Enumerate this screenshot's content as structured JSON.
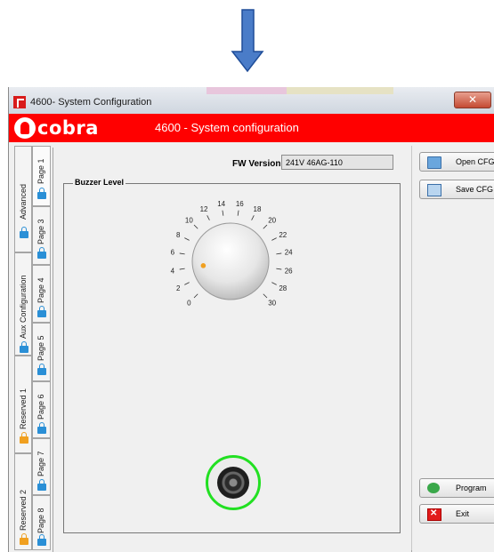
{
  "window": {
    "title": "4600- System Configuration",
    "close_label": "✕"
  },
  "header": {
    "logo_text": "cobra",
    "title": "4600 - System configuration",
    "color": "#ff0000"
  },
  "tabs": {
    "groups": [
      {
        "label": "Advanced",
        "icon": "lock-icon"
      },
      {
        "label": "Aux Configuration",
        "icon": "lock-icon"
      },
      {
        "label": "Reserved 1",
        "icon": "lock-icon"
      },
      {
        "label": "Reserved 2",
        "icon": "lock-icon"
      }
    ],
    "pages": [
      {
        "label": "Page 1"
      },
      {
        "label": "Page 3"
      },
      {
        "label": "Page 4"
      },
      {
        "label": "Page 5"
      },
      {
        "label": "Page 6"
      },
      {
        "label": "Page 7"
      },
      {
        "label": "Page 8"
      }
    ]
  },
  "fw": {
    "label": "FW Version",
    "value": "241V 46AG-110"
  },
  "buzzer": {
    "group_title": "Buzzer Level",
    "scale": [
      "0",
      "2",
      "4",
      "6",
      "8",
      "10",
      "12",
      "14",
      "16",
      "18",
      "20",
      "22",
      "24",
      "26",
      "28",
      "30"
    ],
    "level": 4,
    "accent": "#22e022"
  },
  "buttons": {
    "open": "Open CFG",
    "save": "Save CFG",
    "program": "Program",
    "exit": "Exit"
  }
}
